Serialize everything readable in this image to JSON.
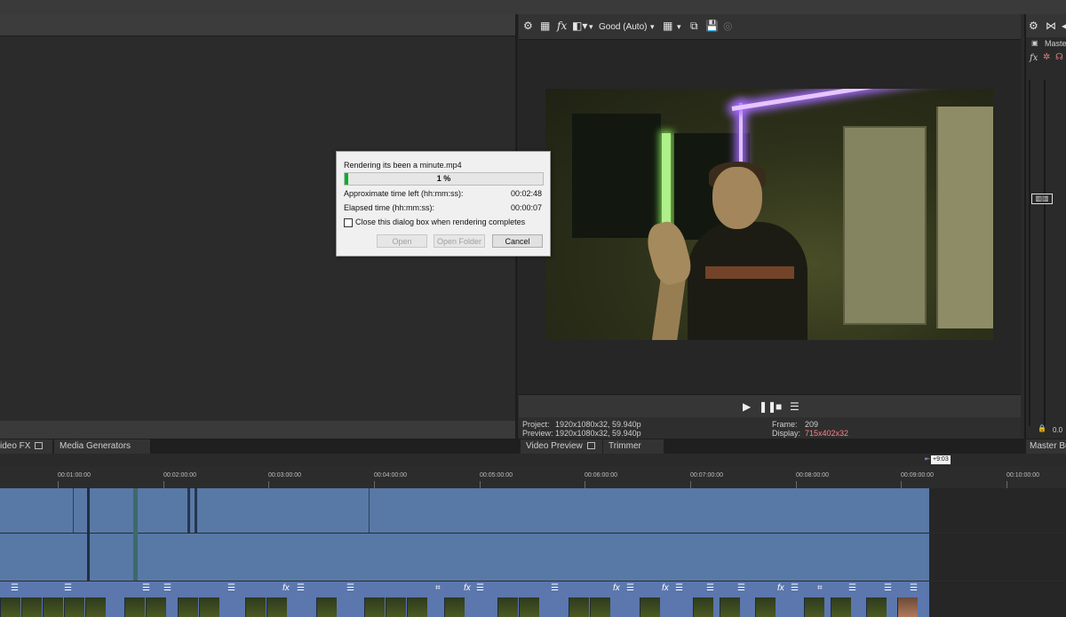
{
  "left_panel": {
    "tabs": [
      {
        "label": "ideo FX"
      },
      {
        "label": "Media Generators"
      }
    ]
  },
  "preview": {
    "quality": "Good (Auto)",
    "tabs": [
      {
        "label": "Video Preview"
      },
      {
        "label": "Trimmer"
      }
    ],
    "info": {
      "project_label": "Project:",
      "project_value": "1920x1080x32, 59.940p",
      "preview_label": "Preview:",
      "preview_value": "1920x1080x32, 59.940p",
      "frame_label": "Frame:",
      "frame_value": "209",
      "display_label": "Display:",
      "display_value": "715x402x32"
    }
  },
  "master": {
    "header_label": "Maste",
    "bottom_tab": "Master Bus",
    "level": "0.0"
  },
  "dialog": {
    "title": "Rendering its been a minute.mp4",
    "progress_text": "1 %",
    "progress_fraction": 0.01,
    "time_left_label": "Approximate time left (hh:mm:ss):",
    "time_left_value": "00:02:48",
    "elapsed_label": "Elapsed time (hh:mm:ss):",
    "elapsed_value": "00:00:07",
    "close_when_done_label": "Close this dialog box when rendering completes",
    "close_when_done_checked": false,
    "open_label": "Open",
    "open_folder_label": "Open Folder",
    "cancel_label": "Cancel"
  },
  "timeline": {
    "cursor_marker": "+9:03",
    "ruler_ticks": [
      "00:01:00:00",
      "00:02:00:00",
      "00:03:00:00",
      "00:04:00:00",
      "00:05:00:00",
      "00:06:00:00",
      "00:07:00:00",
      "00:08:00:00",
      "00:09:00:00",
      "00:10:00:00"
    ]
  },
  "colors": {
    "progress_green": "#06b025",
    "track_blue": "#5879a6",
    "display_value_red": "#ff8080"
  }
}
